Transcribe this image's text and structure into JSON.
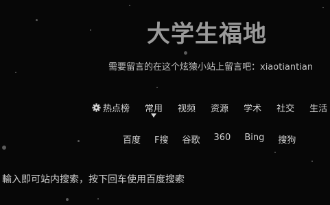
{
  "header": {
    "title": "大学生福地",
    "subtitle": "需要留言的在这个炫猿小站上留言吧：xiaotiantian"
  },
  "nav": {
    "hot_label": "热点榜",
    "items": [
      "常用",
      "视频",
      "资源",
      "学术",
      "社交",
      "生活"
    ],
    "active": "常用"
  },
  "engines": [
    "百度",
    "F搜",
    "谷歌",
    "360",
    "Bing",
    "搜狗"
  ],
  "search": {
    "placeholder": "輸入即可站内搜索，按下回车使用百度搜索",
    "value": ""
  },
  "colors": {
    "background": "#070707",
    "title": "#9a9a9a",
    "text": "#d0d0d0",
    "particle": "#5b5b5b"
  }
}
